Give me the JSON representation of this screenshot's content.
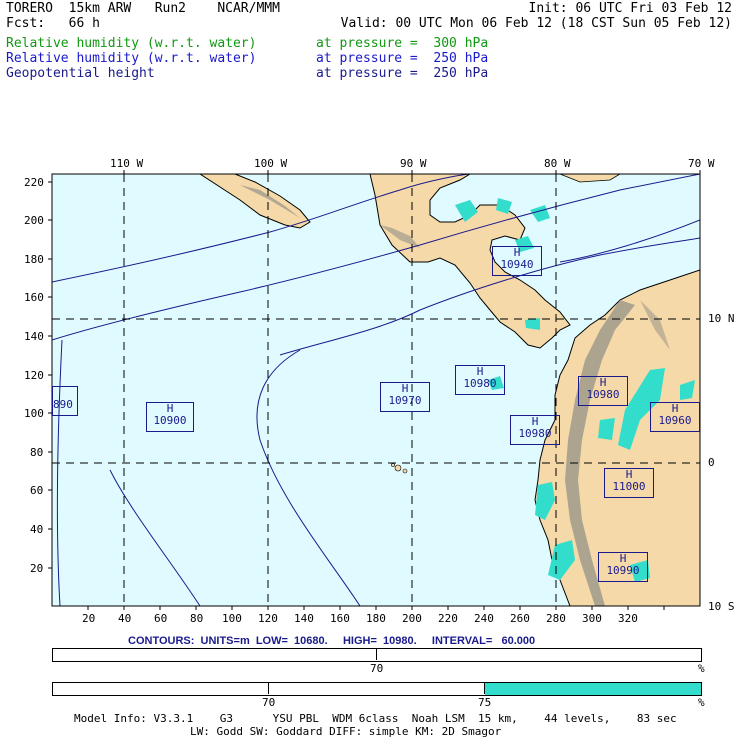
{
  "header": {
    "model": "TORERO  15km ARW   Run2    NCAR/MMM",
    "init": "Init: 06 UTC Fri 03 Feb 12",
    "fcst": "Fcst:   66 h",
    "valid": "Valid: 00 UTC Mon 06 Feb 12 (18 CST Sun 05 Feb 12)",
    "fields": [
      {
        "name": "Relative humidity (w.r.t. water)",
        "level": "at pressure =  300 hPa",
        "color": "#119911"
      },
      {
        "name": "Relative humidity (w.r.t. water)",
        "level": "at pressure =  250 hPa",
        "color": "#1a1acc"
      },
      {
        "name": "Geopotential height",
        "level": "at pressure =  250 hPa",
        "color": "#1a1a8c"
      }
    ]
  },
  "axes": {
    "top_lon": [
      "110 W",
      "100 W",
      "90 W",
      "80 W",
      "70 W"
    ],
    "right_lat": [
      "10 N",
      "0",
      "10 S"
    ],
    "left_y": [
      "220",
      "200",
      "180",
      "160",
      "140",
      "120",
      "100",
      "80",
      "60",
      "40",
      "20"
    ],
    "bottom_x": [
      "20",
      "40",
      "60",
      "80",
      "100",
      "120",
      "140",
      "160",
      "180",
      "200",
      "220",
      "240",
      "260",
      "280",
      "300",
      "320"
    ]
  },
  "highs": [
    {
      "letter": "H",
      "value": "890"
    },
    {
      "letter": "H",
      "value": "10900"
    },
    {
      "letter": "H",
      "value": "10970"
    },
    {
      "letter": "H",
      "value": "10980"
    },
    {
      "letter": "H",
      "value": "10980"
    },
    {
      "letter": "H",
      "value": "10940"
    },
    {
      "letter": "H",
      "value": "10980"
    },
    {
      "letter": "H",
      "value": "10960"
    },
    {
      "letter": "H",
      "value": "11000"
    },
    {
      "letter": "H",
      "value": "10990"
    }
  ],
  "contours_line": "CONTOURS:  UNITS=m  LOW=  10680.     HIGH=  10980.     INTERVAL=   60.000",
  "colorbars": [
    {
      "tick_label": "70",
      "unit": "%",
      "fill_color": null
    },
    {
      "tick_labels": [
        "70",
        "75"
      ],
      "unit": "%",
      "fill_color": "#33ddcc"
    }
  ],
  "footer": {
    "line1": "Model Info: V3.3.1    G3      YSU PBL  WDM 6class  Noah LSM  15 km,    44 levels,    83 sec",
    "line2": "LW: Godd SW: Goddard DIFF: simple KM: 2D Smagor"
  },
  "colors": {
    "ocean": "#e0fbff",
    "land": "#f5d9a8",
    "terrain": "#a09a8c",
    "rh_fill": "#33ddcc",
    "height_contour": "#1a1a8c"
  }
}
